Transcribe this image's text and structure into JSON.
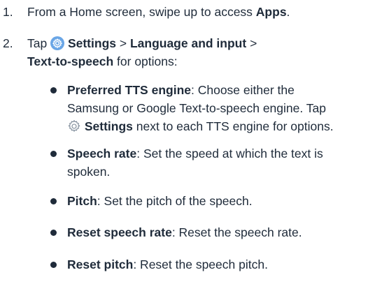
{
  "steps": [
    {
      "number": "1.",
      "pre": "From a Home screen, swipe up to access ",
      "bold": "Apps",
      "post": "."
    },
    {
      "number": "2.",
      "line1_pre": "Tap ",
      "line1_bold": "Settings",
      "line1_sep": " > ",
      "line1_bold2": "Language and input",
      "line1_post": " >",
      "line2_bold": "Text-to-speech",
      "line2_post": " for options:"
    }
  ],
  "bullets": [
    {
      "title": "Preferred TTS engine",
      "text1": ": Choose either the",
      "text2": "Samsung or Google Text-to-speech engine. Tap",
      "text3_bold": "Settings",
      "text3_post": " next to each TTS engine for options."
    },
    {
      "title": "Speech rate",
      "text1": ": Set the speed at which the text is",
      "text2": "spoken."
    },
    {
      "title": "Pitch",
      "text1": ": Set the pitch of the speech."
    },
    {
      "title": "Reset speech rate",
      "text1": ": Reset the speech rate."
    },
    {
      "title": "Reset pitch",
      "text1": ": Reset the speech pitch."
    }
  ],
  "icons": {
    "settings_filled": "settings-gear-icon-filled",
    "settings_outline": "settings-gear-icon-outline"
  },
  "colors": {
    "text": "#1f2b3a",
    "icon_fill": "#6aa6e6"
  }
}
